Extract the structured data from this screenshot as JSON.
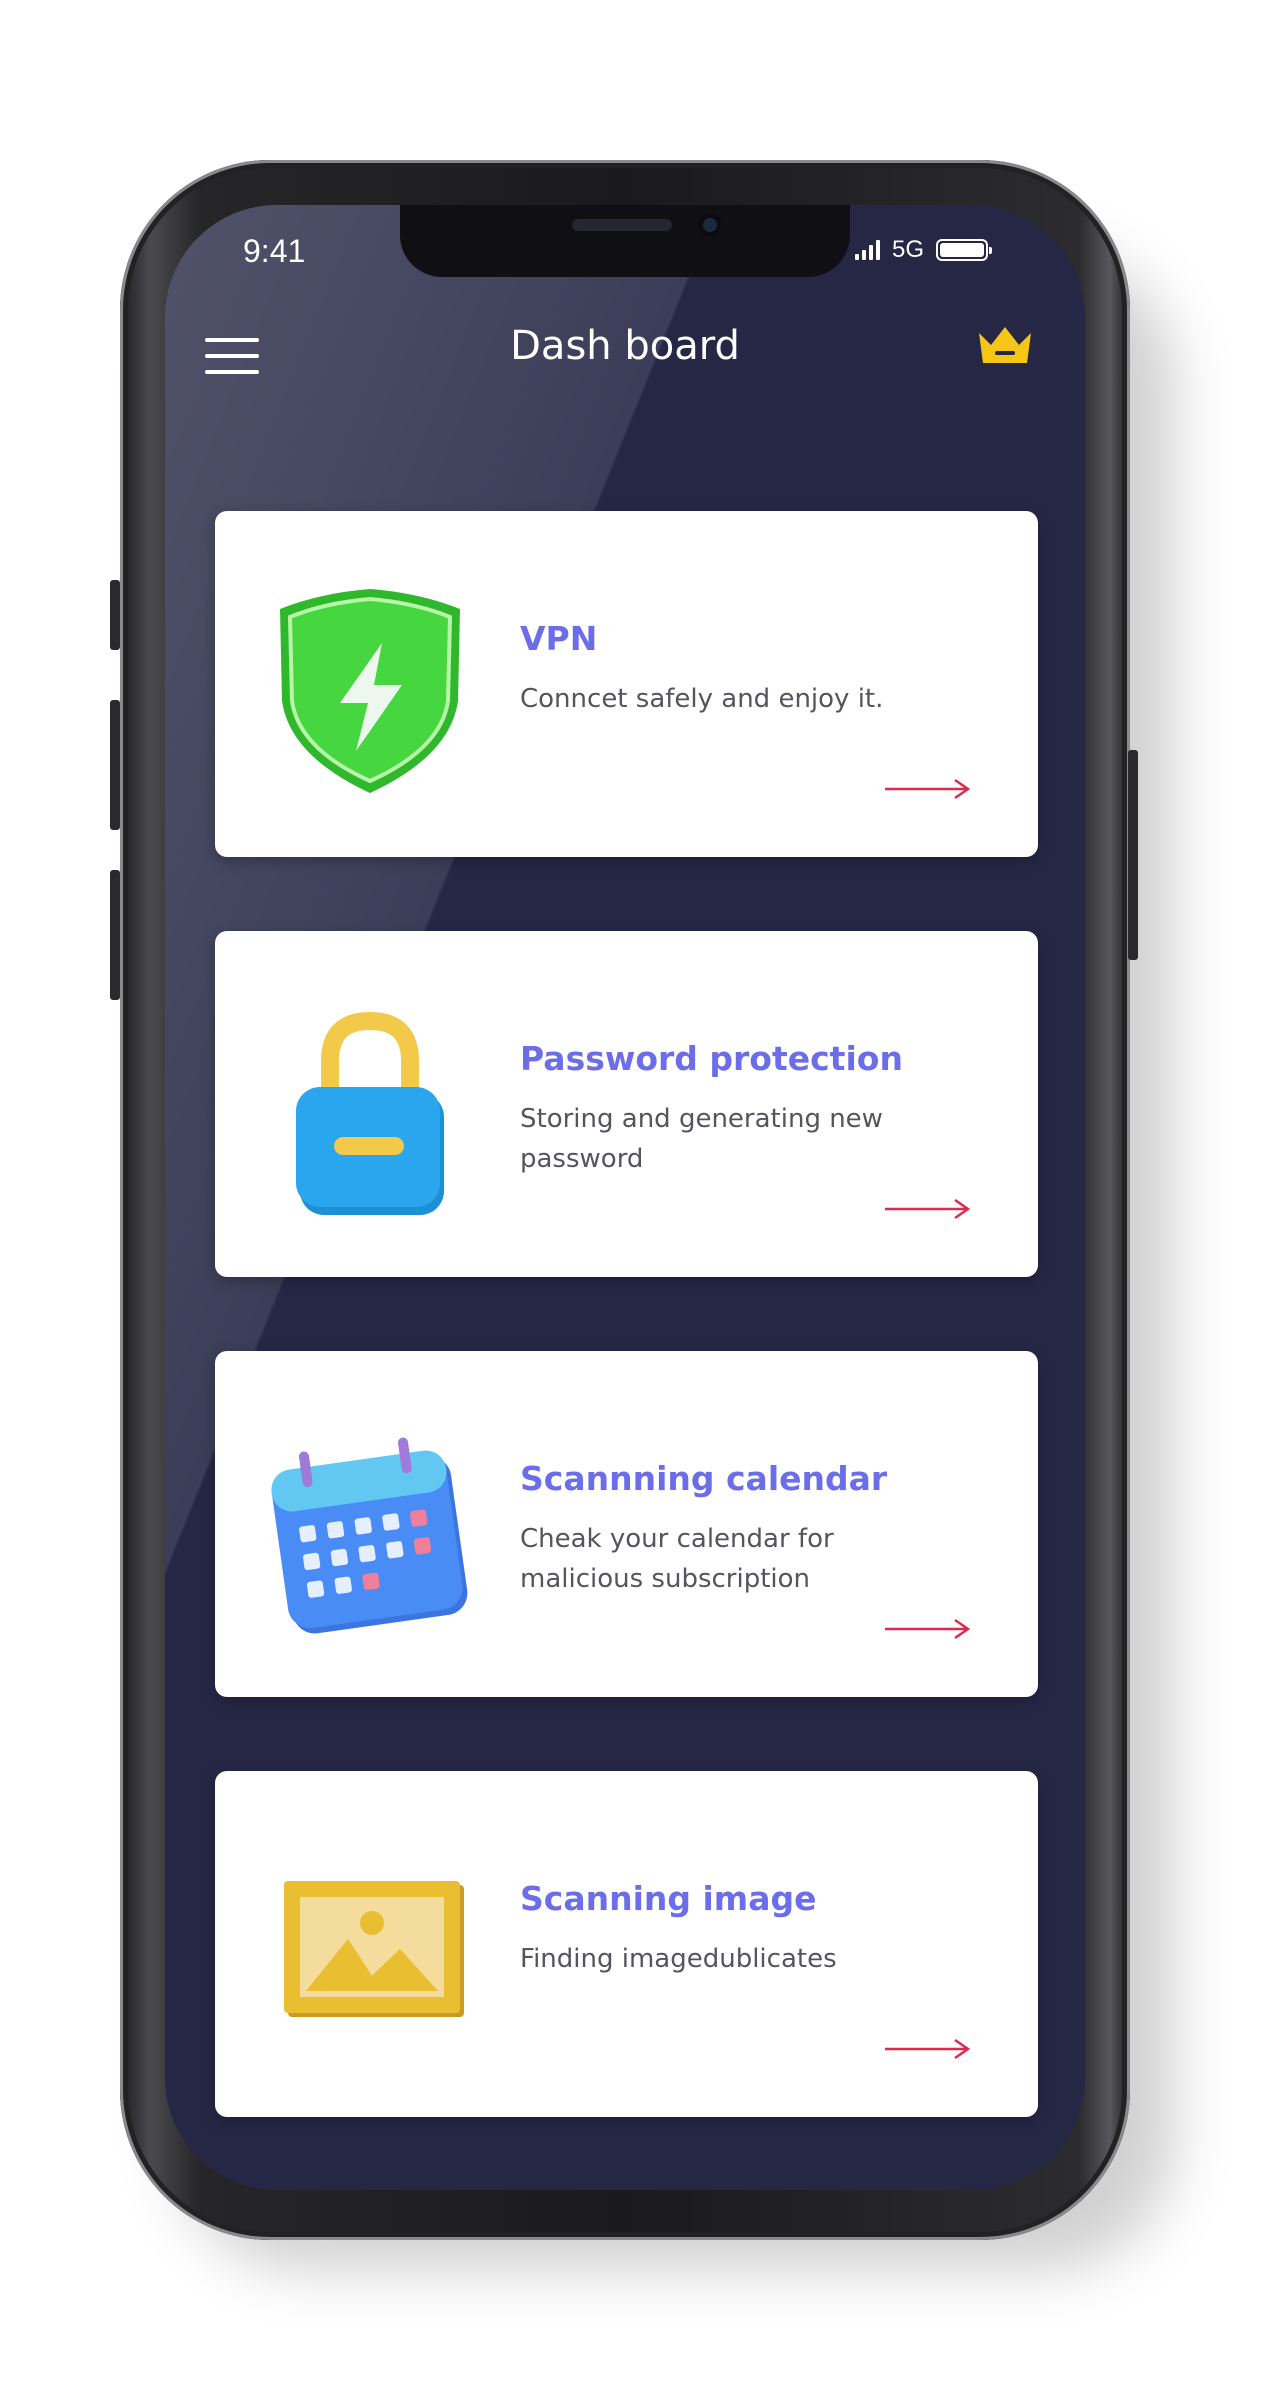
{
  "status_bar": {
    "time": "9:41",
    "network": "5G"
  },
  "header": {
    "title": "Dash board"
  },
  "cards": [
    {
      "title": "VPN",
      "description": "Conncet safely and enjoy it.",
      "icon": "shield-lightning-icon"
    },
    {
      "title": "Password protection",
      "description": "Storing and generating new password",
      "icon": "padlock-icon"
    },
    {
      "title": "Scannning calendar",
      "description": "Cheak your calendar for malicious subscription",
      "icon": "calendar-icon"
    },
    {
      "title": "Scanning image",
      "description": "Finding imagedublicates",
      "icon": "image-icon"
    }
  ],
  "colors": {
    "screen_bg": "#262745",
    "card_title": "#6b6ee8",
    "arrow": "#e0294f",
    "crown": "#f5c518",
    "shield": "#3fcf3a",
    "lock_body": "#2aa6ee",
    "calendar": "#4a8cf5",
    "image_frame": "#e9be30"
  }
}
